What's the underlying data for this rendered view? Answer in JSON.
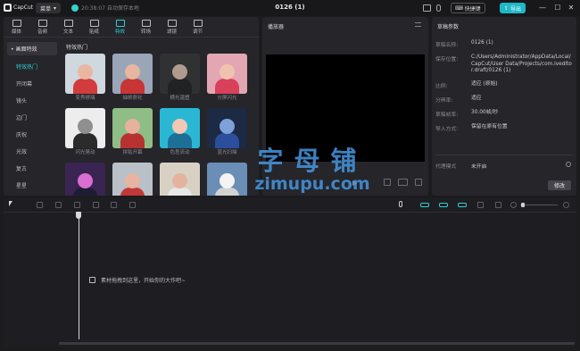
{
  "titlebar": {
    "app_name": "CapCut",
    "menu_label": "菜单",
    "autosave_text": "20:38:07 自动保存本地",
    "project_title": "0126 (1)",
    "shortcut_label": "快捷键",
    "export_label": "导出",
    "accent_color": "#1fb8c8"
  },
  "tools": [
    {
      "label": "媒体",
      "icon": "media-icon"
    },
    {
      "label": "音频",
      "icon": "audio-icon"
    },
    {
      "label": "文本",
      "icon": "text-icon"
    },
    {
      "label": "贴纸",
      "icon": "sticker-icon"
    },
    {
      "label": "特效",
      "icon": "effects-icon",
      "active": true
    },
    {
      "label": "转场",
      "icon": "transition-icon"
    },
    {
      "label": "滤镜",
      "icon": "filter-icon"
    },
    {
      "label": "调节",
      "icon": "adjust-icon"
    }
  ],
  "categories": {
    "header": "• 画面特效",
    "items": [
      "特效热门",
      "开闭幕",
      "镜头",
      "边门",
      "庆祝",
      "光效",
      "复古",
      "星星"
    ]
  },
  "effects": {
    "title": "特效热门",
    "items": [
      {
        "label": "变秀擦璃",
        "bg": "#cfd7df",
        "skin": "#e9b7a1",
        "cloth": "#d23c3c"
      },
      {
        "label": "抽帧侧化",
        "bg": "#9aa6b8",
        "skin": "#e7b6a0",
        "cloth": "#c73535"
      },
      {
        "label": "横光温塑",
        "bg": "#2f3133",
        "skin": "#b09a8e",
        "cloth": "#202224"
      },
      {
        "label": "分屏闪光",
        "bg": "#e2a7b2",
        "skin": "#f0c3b1",
        "cloth": "#d9405a"
      },
      {
        "label": "闪光晃动",
        "bg": "#ededed",
        "skin": "#8f8f8f",
        "cloth": "#2b2b2b"
      },
      {
        "label": "拼贴开幕",
        "bg": "#8fbd86",
        "skin": "#e6b29d",
        "cloth": "#b83232"
      },
      {
        "label": "色差流动",
        "bg": "#2ab7d4",
        "skin": "#f1c7b6",
        "cloth": "#1e6f95"
      },
      {
        "label": "蓝光扫描",
        "bg": "#1c2a44",
        "skin": "#7ea1d9",
        "cloth": "#2b4f9c"
      },
      {
        "label": "",
        "bg": "#3a2452",
        "skin": "#d96fd0",
        "cloth": "#1d1d36"
      },
      {
        "label": "",
        "bg": "#b9c0c8",
        "skin": "#e6b4a0",
        "cloth": "#c23838"
      },
      {
        "label": "",
        "bg": "#d8d1c3",
        "skin": "#e3b49d",
        "cloth": "#e8e8e8"
      },
      {
        "label": "",
        "bg": "#6a8eb5",
        "skin": "#f4f4f4",
        "cloth": "#d2d2d2"
      }
    ]
  },
  "player": {
    "title": "播放器"
  },
  "draft": {
    "title": "草稿参数",
    "rows": [
      {
        "k": "草稿名称:",
        "v": "0126 (1)"
      },
      {
        "k": "保存位置:",
        "v": "C:/Users/Administrator/AppData/Local/CapCut/User Data/Projects/com.lveditor.draft/0126 (1)"
      },
      {
        "k": "比例:",
        "v": "适应 (原始)"
      },
      {
        "k": "分辨率:",
        "v": "适应"
      },
      {
        "k": "草稿帧率:",
        "v": "30.00帧/秒"
      },
      {
        "k": "导入方式:",
        "v": "保留在原有位置"
      }
    ],
    "proxy_key": "代理模式",
    "proxy_value": "未开启",
    "modify_label": "修改"
  },
  "timeline": {
    "drop_hint": "素材拖拽到这里，开始你的大作吧~"
  },
  "watermark": {
    "line1": "字母铺",
    "line2": "zimupu.com"
  }
}
